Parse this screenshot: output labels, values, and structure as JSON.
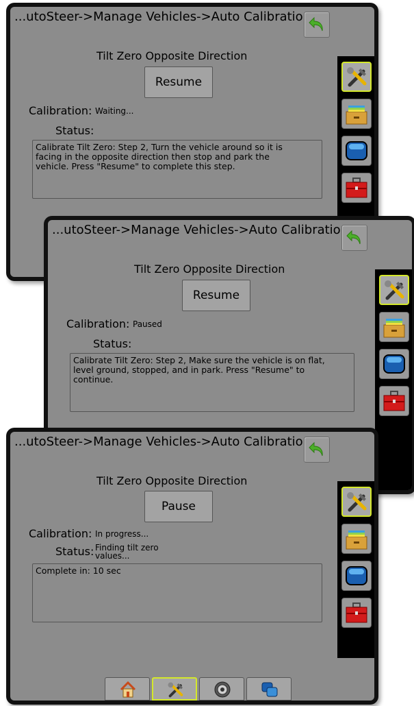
{
  "panels": [
    {
      "title": "...utoSteer->Manage Vehicles->Auto Calibration",
      "heading": "Tilt Zero Opposite Direction",
      "button_label": "Resume",
      "calibration_label": "Calibration:",
      "calibration_value": "Waiting...",
      "status_label": "Status:",
      "status_value": "",
      "message_lines": [
        "Calibrate Tilt Zero: Step 2, Turn the vehicle around so it is",
        "facing in the opposite direction then stop and park the",
        "vehicle. Press \"Resume\" to complete this step."
      ]
    },
    {
      "title": "...utoSteer->Manage Vehicles->Auto Calibration",
      "heading": "Tilt Zero Opposite Direction",
      "button_label": "Resume",
      "calibration_label": "Calibration:",
      "calibration_value": "Paused",
      "status_label": "Status:",
      "status_value": "",
      "message_lines": [
        "Calibrate Tilt Zero: Step 2, Make sure the vehicle is on flat,",
        "level ground, stopped, and in park. Press \"Resume\" to",
        "continue."
      ]
    },
    {
      "title": "...utoSteer->Manage Vehicles->Auto Calibration",
      "heading": "Tilt Zero Opposite Direction",
      "button_label": "Pause",
      "calibration_label": "Calibration:",
      "calibration_value": "In progress...",
      "status_label": "Status:",
      "status_value_line1": "Finding tilt zero",
      "status_value_line2": "values...",
      "message_lines": [
        "Complete in: 10 sec"
      ]
    }
  ],
  "sidebar_icons": [
    "tools-icon",
    "data-drawer-icon",
    "console-screen-icon",
    "toolbox-icon"
  ],
  "bottom_tabs": [
    "home-icon",
    "tools-icon",
    "guidance-dial-icon",
    "multi-screen-icon"
  ],
  "colors": {
    "screen_bg": "#8c8c8c",
    "frame": "#111111",
    "active_highlight": "#d4e82a",
    "back_arrow": "#4caf2a"
  }
}
